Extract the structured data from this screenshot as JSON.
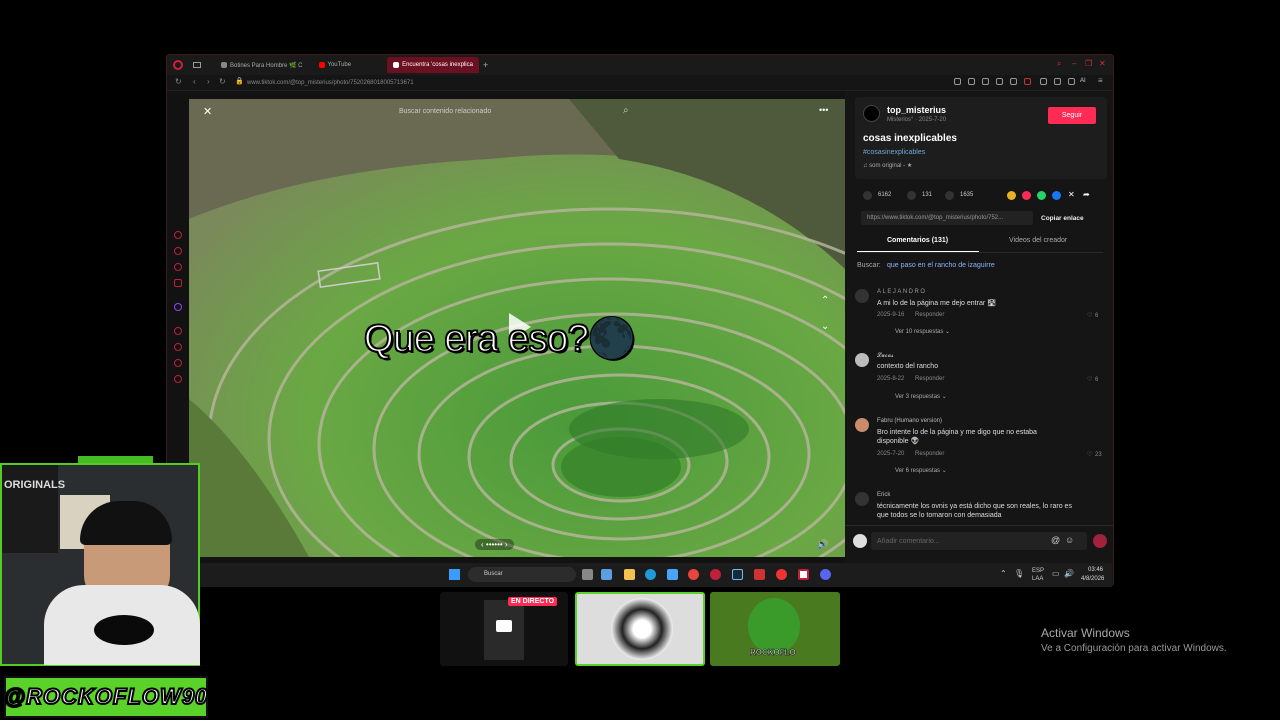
{
  "browser": {
    "tabs": [
      {
        "label": "Botines Para Hombre 🌿 C",
        "icon_color": "#888888"
      },
      {
        "label": "YouTube",
        "icon_color": "#ff0000"
      },
      {
        "label": "Encuentra 'cosas inexplica",
        "icon_color": "#ffffff",
        "active": true
      }
    ],
    "new_tab": "+",
    "url": "www.tiktok.com/@top_misterius/photo/7520268018005713671",
    "ai_label": "AI"
  },
  "video": {
    "search_placeholder": "Buscar contenido relacionado",
    "caption": "Que era eso?🌑",
    "close": "✕",
    "more": "•••",
    "dots": "‹ •••••• ›"
  },
  "creator": {
    "username": "top_misterius",
    "subtitle": "Misterios° · 2025-7-20",
    "follow_label": "Seguir",
    "title": "cosas inexplicables",
    "hashtag": "#cosasinexplicables",
    "sound": "♫ som original - ★"
  },
  "stats": {
    "likes": "6162",
    "comments": "131",
    "saves": "1635"
  },
  "share": {
    "link": "https://www.tiktok.com/@top_misterius/photo/752...",
    "copy_label": "Copiar enlace"
  },
  "tabs": {
    "comments": "Comentarios (131)",
    "videos": "Videos del creador"
  },
  "search_suggest": {
    "prefix": "Buscar:",
    "query": "que paso en el rancho de izaguirre"
  },
  "comments": [
    {
      "user": "ALEJANDRO",
      "text": "A mi lo de la página me dejo entrar 🛣",
      "date": "2025-9-16",
      "reply": "Responder",
      "likes": "6",
      "more": "Ver 10 respuestas ⌄"
    },
    {
      "user": "𝓛𝓾𝓬𝓪𝓼",
      "text": "contexto del rancho",
      "date": "2025-8-22",
      "reply": "Responder",
      "likes": "6",
      "more": "Ver 3 respuestas ⌄"
    },
    {
      "user": "Fabru (Humano version)",
      "text": "Bro intente lo de la página y me digo que no estaba disponible 👽",
      "date": "2025-7-20",
      "reply": "Responder",
      "likes": "23",
      "more": "Ver 6 respuestas ⌄"
    },
    {
      "user": "Erick",
      "text": "técnicamente los ovnis ya está dicho que son reales, lo raro es que todos se lo tomaron con demasiada",
      "date": "",
      "reply": "",
      "likes": "",
      "more": ""
    }
  ],
  "comment_input": {
    "placeholder": "Añadir comentario..."
  },
  "taskbar": {
    "search": "Buscar",
    "lang": "ESP",
    "lang2": "LAA",
    "time": "03:46",
    "date": "4/8/2026"
  },
  "stream": {
    "live_badge": "EN DIRECTO",
    "handle": "@ROCKOFLOW90",
    "cam_label": "ORIGINALS",
    "logo_text": "ROCKOFLO"
  },
  "windows_activation": {
    "title": "Activar Windows",
    "subtitle": "Ve a Configuración para activar Windows."
  },
  "colors": {
    "accent": "#fe2c55",
    "tag_green": "#5ad22a",
    "hashtag": "#6fa8dc"
  }
}
